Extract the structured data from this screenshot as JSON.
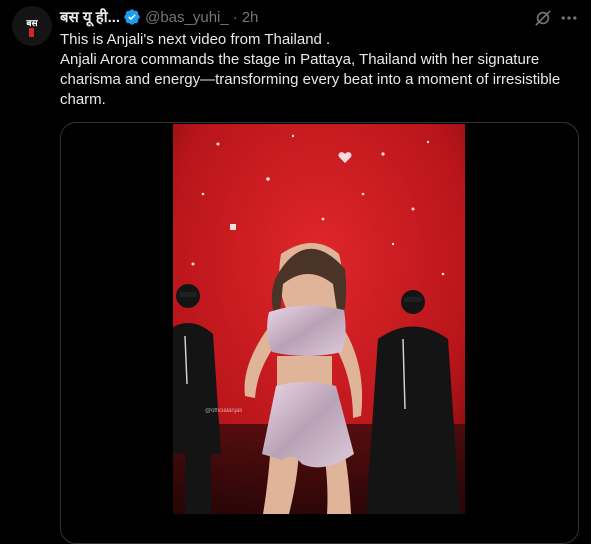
{
  "author": {
    "avatar_text": "बस",
    "display_name": "बस यू ही...",
    "handle": "@bas_yuhi_",
    "separator": "·",
    "time": "2h",
    "verified": true
  },
  "header_icons": [
    "grok-icon",
    "more-icon"
  ],
  "post": {
    "line1": "This is Anjali's next video from Thailand .",
    "line2": "Anjali Arora commands the stage in Pattaya, Thailand with her signature charisma and energy—transforming every beat into a moment of irresistible charm."
  },
  "media": {
    "type": "video",
    "watermark": "@officialanjali"
  },
  "colors": {
    "background": "#000000",
    "text": "#e7e9ea",
    "muted": "#71767b",
    "verified": "#1d9bf0",
    "border": "#2f3336",
    "stage_red": "#c91a1f"
  }
}
